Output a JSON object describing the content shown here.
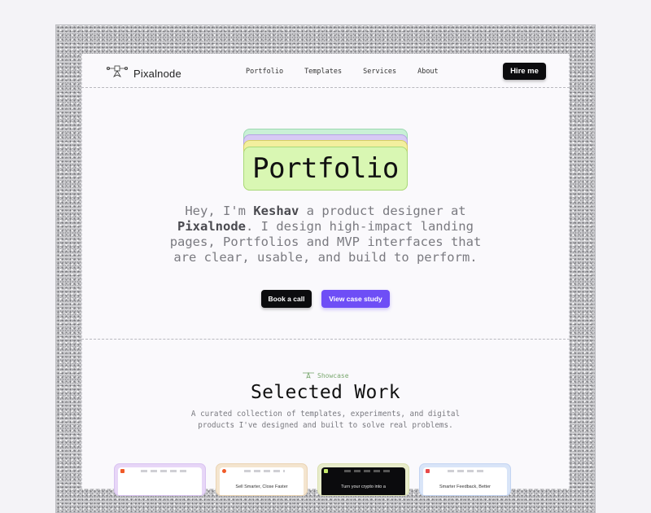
{
  "brand": {
    "name": "Pixalnode"
  },
  "nav": {
    "links": [
      "Portfolio",
      "Templates",
      "Services",
      "About"
    ],
    "hire_label": "Hire me"
  },
  "hero": {
    "title": "Portfolio",
    "intro": {
      "greeting": "Hey, I'm ",
      "name": "Keshav",
      "role": " a product designer at ",
      "company": "Pixalnode",
      "rest": ". I design high-impact landing pages, Portfolios and MVP interfaces that are clear, usable, and build to perform."
    },
    "cta_primary": "Book a call",
    "cta_secondary": "View case study"
  },
  "work": {
    "badge": "Showcase",
    "title": "Selected Work",
    "description": "A curated collection of templates, experiments, and digital products I've designed and built to solve real problems.",
    "thumbnails": [
      {
        "caption": ""
      },
      {
        "caption": "Sell Smarter, Close Faster"
      },
      {
        "caption": "Turn your crypto into a"
      },
      {
        "caption": "Smarter Feedback, Better"
      }
    ]
  },
  "colors": {
    "accent_purple": "#6e4ef6",
    "card_green": "#d9f7b3",
    "card_yellow": "#f3ef9e",
    "card_lavender": "#d7c9f5",
    "card_mint": "#c9f0d6"
  },
  "icons": {
    "logo": "pen-tool-icon",
    "badge": "sparkle-icon"
  }
}
